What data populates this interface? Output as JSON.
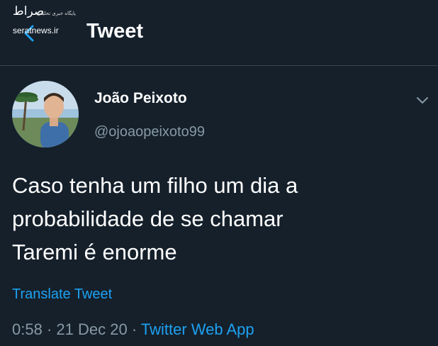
{
  "header": {
    "title": "Tweet",
    "watermark": {
      "logo_text": "صراط",
      "tagline": "پایگاه خبری تحلیلی",
      "site": "seratnews.ir"
    }
  },
  "tweet": {
    "author_name": "João Peixoto",
    "author_handle": "@ojoaopeixoto99",
    "text_lines": [
      "Caso tenha um filho um dia a",
      "probabilidade de se chamar",
      "Taremi é enorme"
    ],
    "translate_label": "Translate Tweet",
    "time": "0:58",
    "sep1": "·",
    "date": "21 Dec 20",
    "sep2": "·",
    "source": "Twitter Web App"
  },
  "colors": {
    "background": "#15202b",
    "accent": "#1da1f2",
    "secondary_text": "#8899a6",
    "divider": "#38444d"
  },
  "icons": {
    "back": "arrow-left-icon",
    "more": "chevron-down-icon"
  }
}
